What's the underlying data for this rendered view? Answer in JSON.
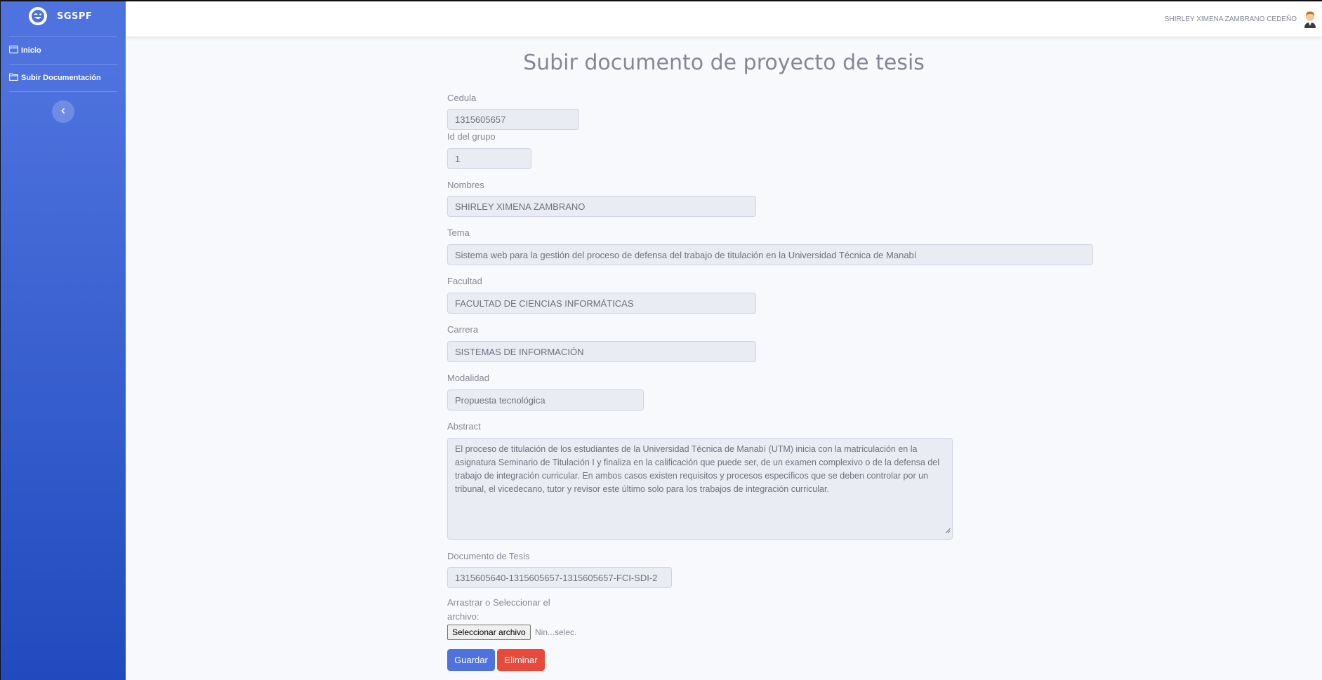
{
  "brand": {
    "name": "SGSPF",
    "logo_icon": "laugh-wink-icon"
  },
  "sidebar": {
    "items": [
      {
        "label": "Inicio",
        "icon": "calendar-icon"
      },
      {
        "label": "Subir Documentación",
        "icon": "folder-icon"
      }
    ],
    "toggle_icon": "chevron-left-icon"
  },
  "topbar": {
    "user_name": "SHIRLEY XIMENA ZAMBRANO CEDEÑO",
    "avatar_icon": "user-avatar-icon"
  },
  "page": {
    "title": "Subir documento de proyecto de tesis"
  },
  "form": {
    "cedula": {
      "label": "Cedula",
      "value": "1315605657"
    },
    "grupo": {
      "label": "Id del grupo",
      "value": "1"
    },
    "nombres": {
      "label": "Nombres",
      "value": "SHIRLEY XIMENA ZAMBRANO"
    },
    "tema": {
      "label": "Tema",
      "value": "Sistema web para la gestión del proceso de defensa del trabajo de titulación en la Universidad Técnica de Manabí"
    },
    "facultad": {
      "label": "Facultad",
      "value": "FACULTAD DE CIENCIAS INFORMÁTICAS"
    },
    "carrera": {
      "label": "Carrera",
      "value": "SISTEMAS DE INFORMACIÓN"
    },
    "modalidad": {
      "label": "Modalidad",
      "value": "Propuesta tecnológica"
    },
    "abstract": {
      "label": "Abstract",
      "value": " El proceso de titulación de los estudiantes de la Universidad Técnica de Manabí (UTM) inicia con la matriculación en la asignatura Seminario de Titulación I y finaliza en la calificación que puede ser, de un examen complexivo o de la defensa del trabajo de integración curricular. En ambos casos existen requisitos y procesos específicos que se deben controlar por un tribunal, el vicedecano, tutor y revisor este último solo para los trabajos de integración curricular."
    },
    "documento": {
      "label": "Documento de Tesis",
      "value": "1315605640-1315605657-1315605657-FCI-SDI-2"
    },
    "archivo": {
      "label_line1": "Arrastrar o Seleccionar el",
      "label_line2": "archivo:",
      "button": "Seleccionar archivo",
      "status": "Nin...selec."
    },
    "actions": {
      "save": "Guardar",
      "delete": "Eliminar"
    }
  },
  "colors": {
    "primary": "#4e73df",
    "danger": "#e74a3b",
    "sidebar_top": "#4e73df",
    "sidebar_bottom": "#224abe"
  }
}
